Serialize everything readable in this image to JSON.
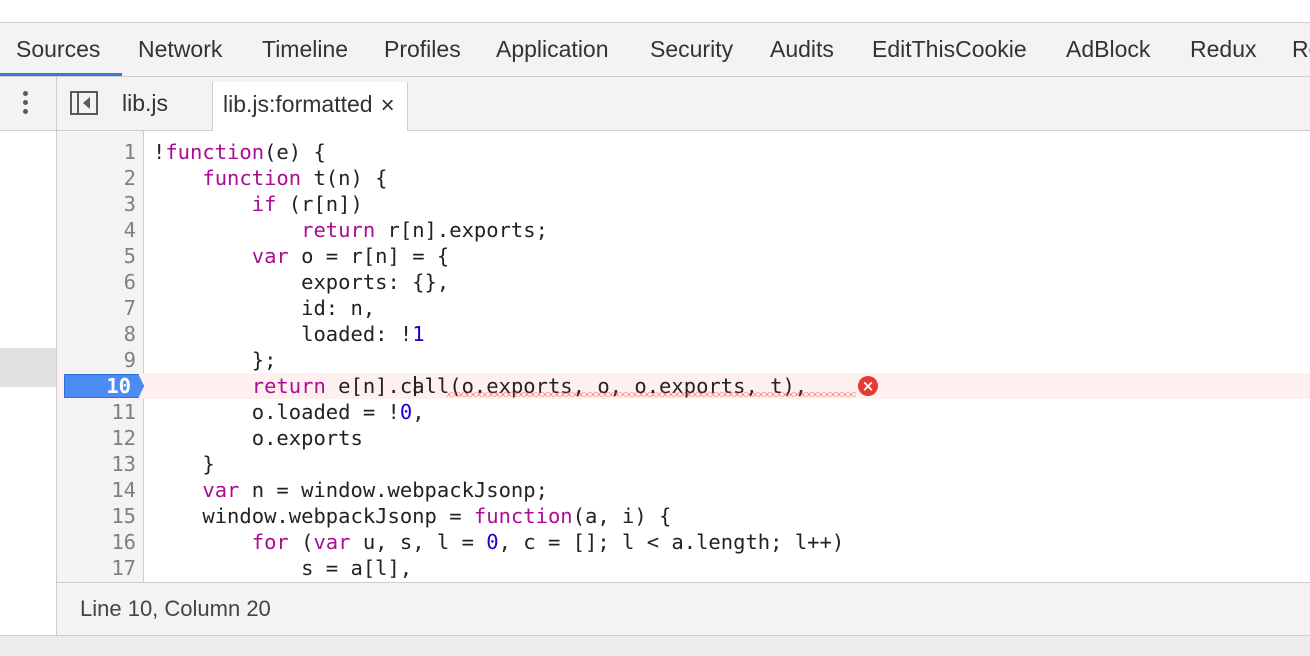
{
  "panel_tabs": [
    "Sources",
    "Network",
    "Timeline",
    "Profiles",
    "Application",
    "Security",
    "Audits",
    "EditThisCookie",
    "AdBlock",
    "Redux",
    "Re"
  ],
  "active_panel": "Sources",
  "files": {
    "file1": "lib.js",
    "file2": "lib.js:formatted",
    "close_glyph": "×"
  },
  "editor": {
    "paused_line": "10",
    "error_glyph": "×",
    "lines": [
      {
        "n": "1",
        "segments": [
          {
            "t": "!"
          },
          {
            "t": "function",
            "c": "kw"
          },
          {
            "t": "(e) {"
          }
        ]
      },
      {
        "n": "2",
        "segments": [
          {
            "t": "    "
          },
          {
            "t": "function",
            "c": "kw"
          },
          {
            "t": " t(n) {"
          }
        ]
      },
      {
        "n": "3",
        "segments": [
          {
            "t": "        "
          },
          {
            "t": "if",
            "c": "kw"
          },
          {
            "t": " (r[n])"
          }
        ]
      },
      {
        "n": "4",
        "segments": [
          {
            "t": "            "
          },
          {
            "t": "return",
            "c": "kw"
          },
          {
            "t": " r[n].exports;"
          }
        ]
      },
      {
        "n": "5",
        "segments": [
          {
            "t": "        "
          },
          {
            "t": "var",
            "c": "kw"
          },
          {
            "t": " o = r[n] = {"
          }
        ]
      },
      {
        "n": "6",
        "segments": [
          {
            "t": "            exports: {},"
          }
        ]
      },
      {
        "n": "7",
        "segments": [
          {
            "t": "            id: n,"
          }
        ]
      },
      {
        "n": "8",
        "segments": [
          {
            "t": "            loaded: !"
          },
          {
            "t": "1",
            "c": "num"
          }
        ]
      },
      {
        "n": "9",
        "segments": [
          {
            "t": "        };"
          }
        ]
      },
      {
        "n": "10",
        "segments": [
          {
            "t": "        "
          },
          {
            "t": "return",
            "c": "kw"
          },
          {
            "t": " e[n].call(o.exports, o, o.exports, t),"
          }
        ]
      },
      {
        "n": "11",
        "segments": [
          {
            "t": "        o.loaded = !"
          },
          {
            "t": "0",
            "c": "num"
          },
          {
            "t": ","
          }
        ]
      },
      {
        "n": "12",
        "segments": [
          {
            "t": "        o.exports"
          }
        ]
      },
      {
        "n": "13",
        "segments": [
          {
            "t": "    }"
          }
        ]
      },
      {
        "n": "14",
        "segments": [
          {
            "t": "    "
          },
          {
            "t": "var",
            "c": "kw"
          },
          {
            "t": " n = window.webpackJsonp;"
          }
        ]
      },
      {
        "n": "15",
        "segments": [
          {
            "t": "    window.webpackJsonp = "
          },
          {
            "t": "function",
            "c": "kw"
          },
          {
            "t": "(a, i) {"
          }
        ]
      },
      {
        "n": "16",
        "segments": [
          {
            "t": "        "
          },
          {
            "t": "for",
            "c": "kw"
          },
          {
            "t": " ("
          },
          {
            "t": "var",
            "c": "kw"
          },
          {
            "t": " u, s, l = "
          },
          {
            "t": "0",
            "c": "num"
          },
          {
            "t": ", c = []; l < a.length; l++)"
          }
        ]
      },
      {
        "n": "17",
        "segments": [
          {
            "t": "            s = a[l],"
          }
        ]
      }
    ]
  },
  "status": {
    "cursor_position": "Line 10, Column 20"
  },
  "colors": {
    "accent": "#3879d9",
    "keyword": "#aa0d91",
    "number": "#1c00cf",
    "breakpoint": "#4b8bf4",
    "error": "#e53935"
  }
}
